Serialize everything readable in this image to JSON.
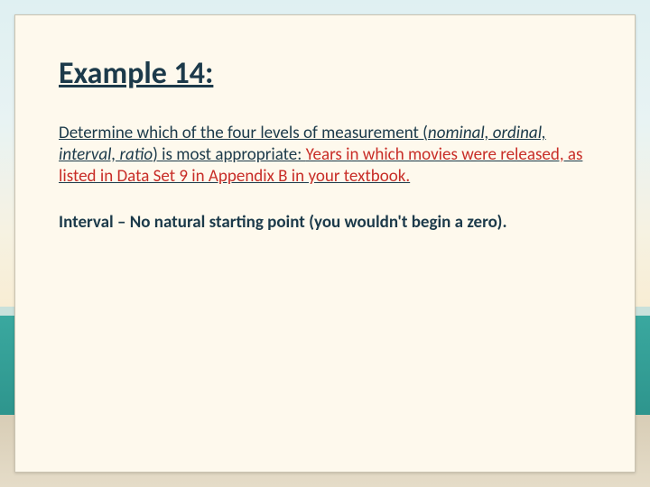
{
  "slide": {
    "title": "Example 14:",
    "question": {
      "lead": "Determine which of the four levels of measurement (",
      "measures": "nominal, ordinal, interval, ratio",
      "mid": ") is most appropriate: ",
      "prompt": "Years in which movies were released, as listed in Data Set 9 in Appendix B in your textbook."
    },
    "answer": "Interval – No natural starting point (you wouldn't begin a zero)."
  }
}
